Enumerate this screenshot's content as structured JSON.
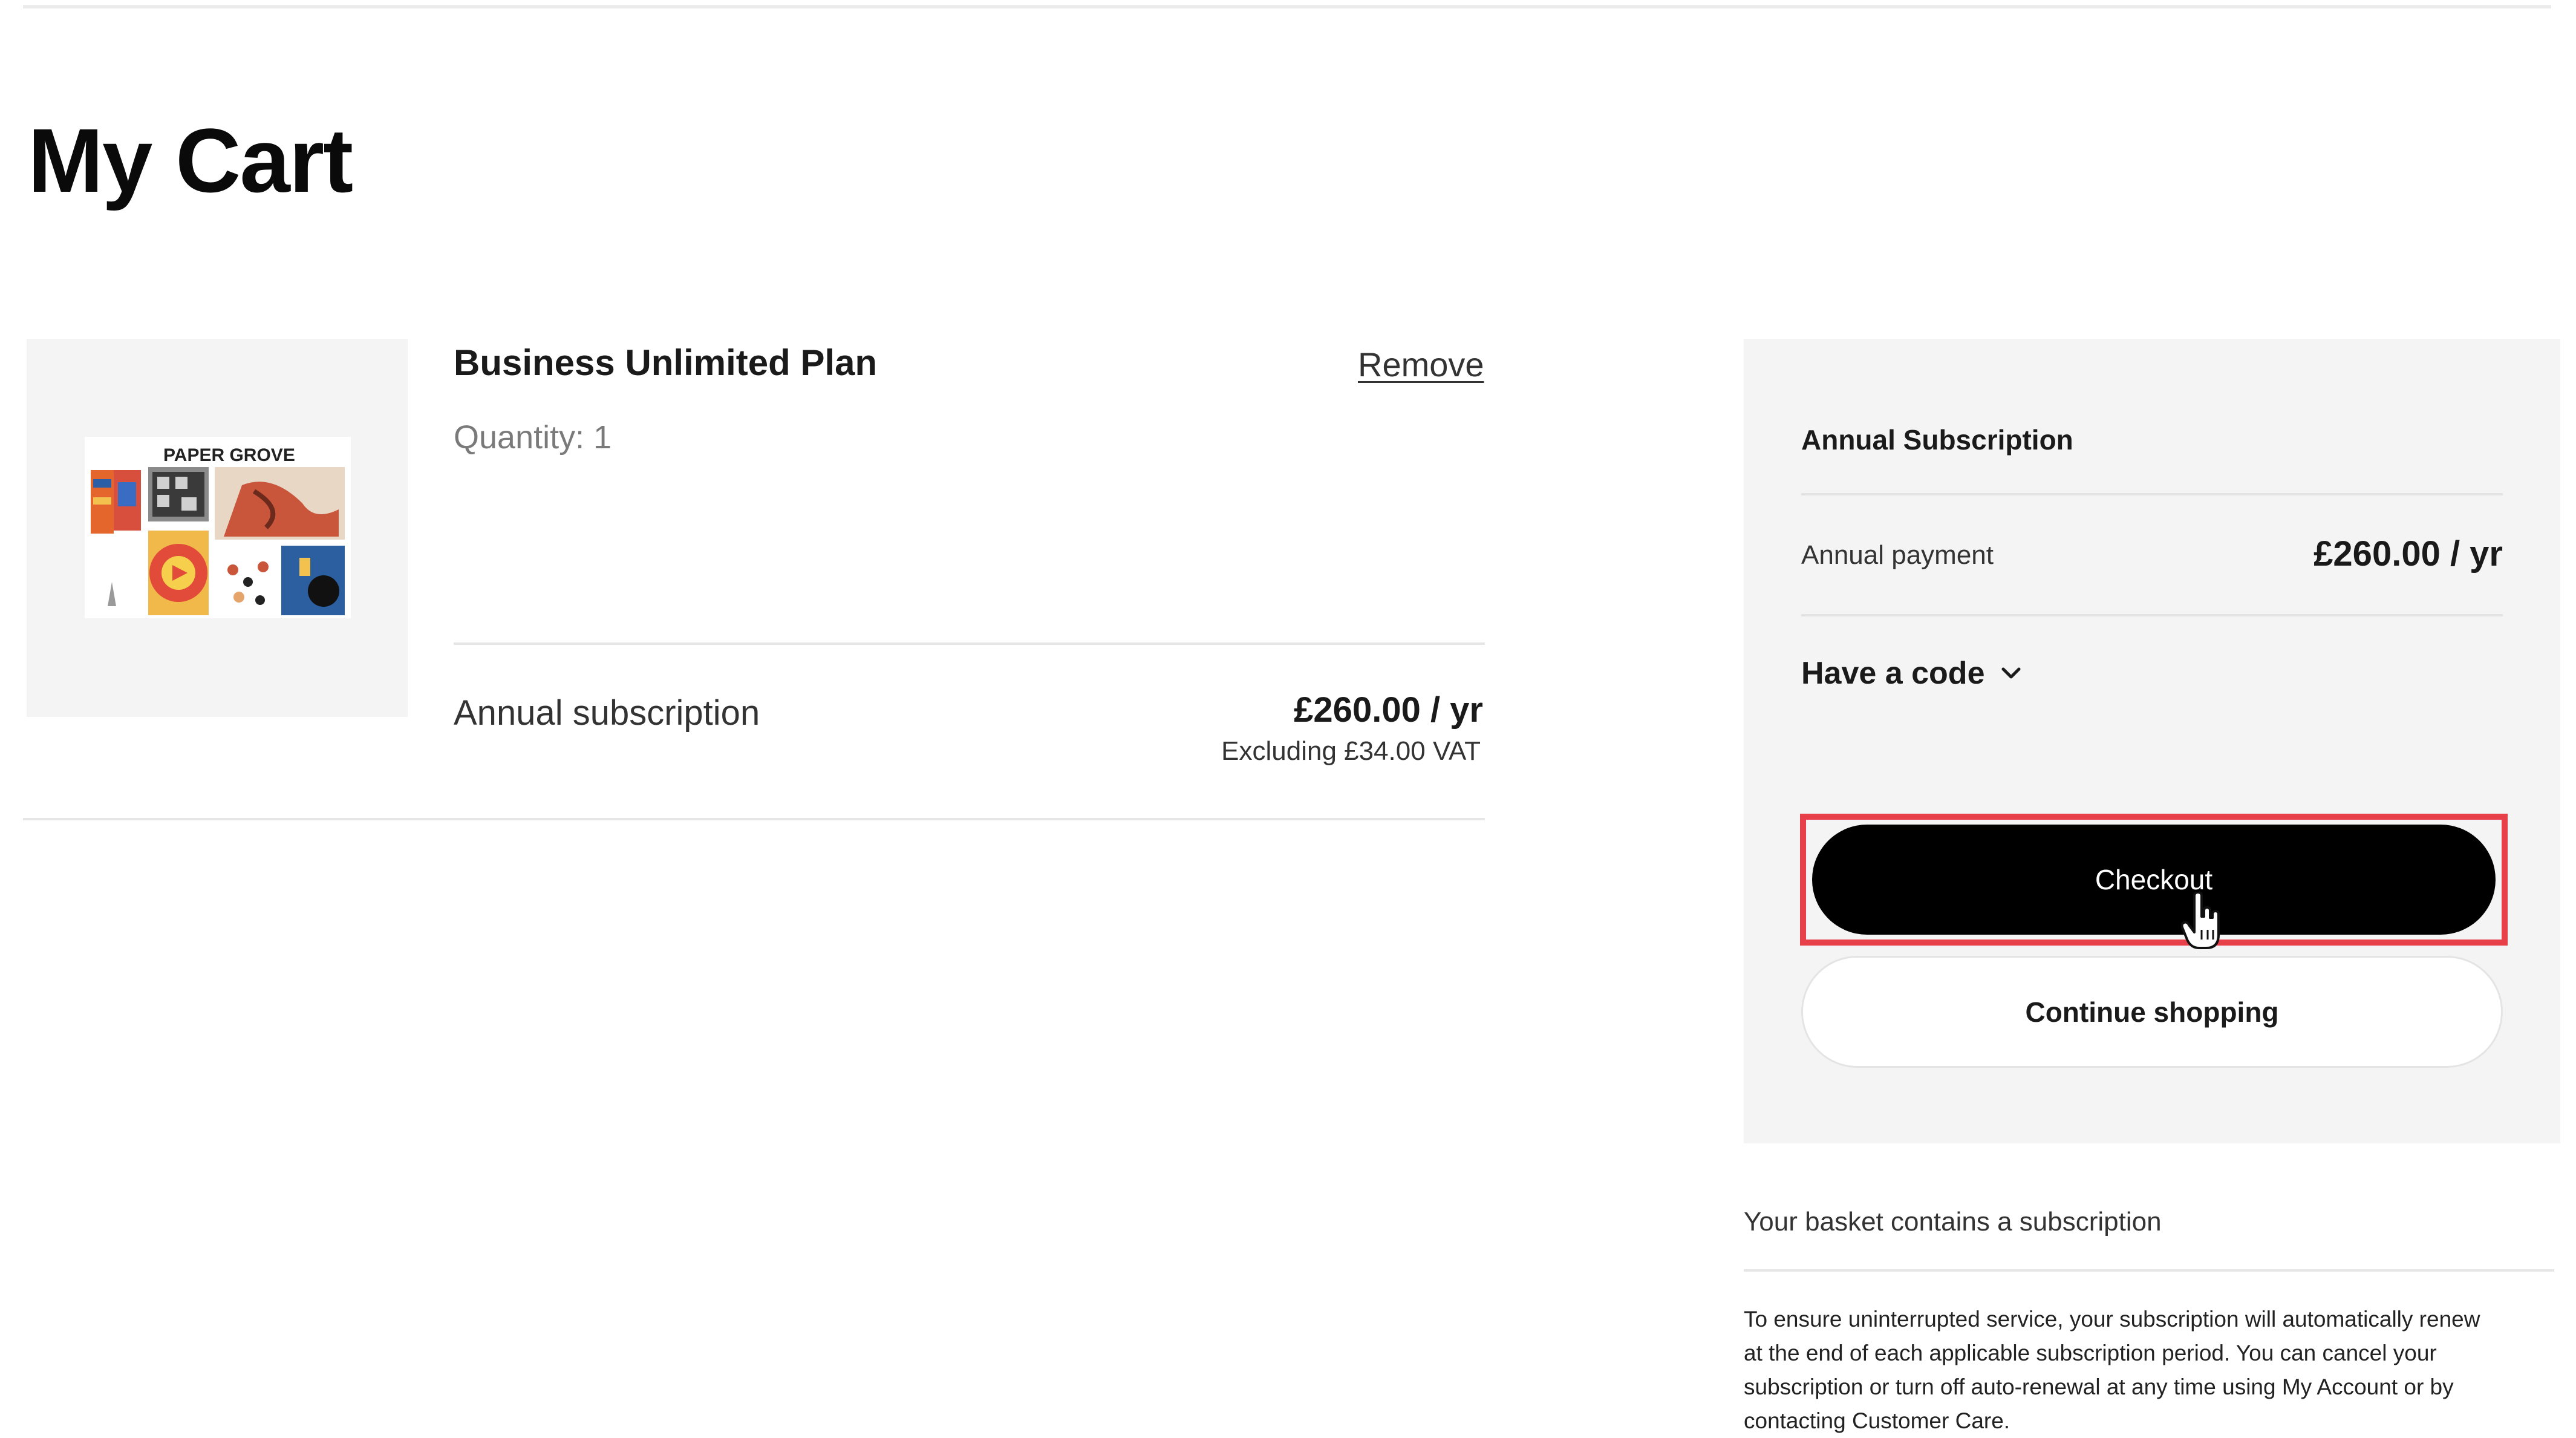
{
  "page": {
    "title": "My Cart"
  },
  "cart_item": {
    "image_text": "PAPER GROVE",
    "name": "Business Unlimited Plan",
    "remove_label": "Remove",
    "quantity": "Quantity: 1",
    "line_label": "Annual subscription",
    "price": "£260.00 / yr",
    "vat_note": "Excluding £34.00 VAT"
  },
  "summary": {
    "heading": "Annual Subscription",
    "annual_label": "Annual payment",
    "annual_price": "£260.00 / yr",
    "code_toggle_label": "Have a code",
    "checkout_label": "Checkout",
    "continue_label": "Continue shopping"
  },
  "notice": {
    "title": "Your basket contains a subscription",
    "body": "To ensure uninterrupted service, your subscription will automatically renew at the end of each applicable subscription period. You can cancel your subscription or turn off auto-renewal at any time using My Account or by contacting Customer Care."
  },
  "colors": {
    "highlight": "#e8404a",
    "panel_bg": "#f4f4f4",
    "checkout_bg": "#000000"
  },
  "icons": {
    "code_toggle": "chevron-down-icon",
    "pointer": "hand-pointer-icon"
  }
}
